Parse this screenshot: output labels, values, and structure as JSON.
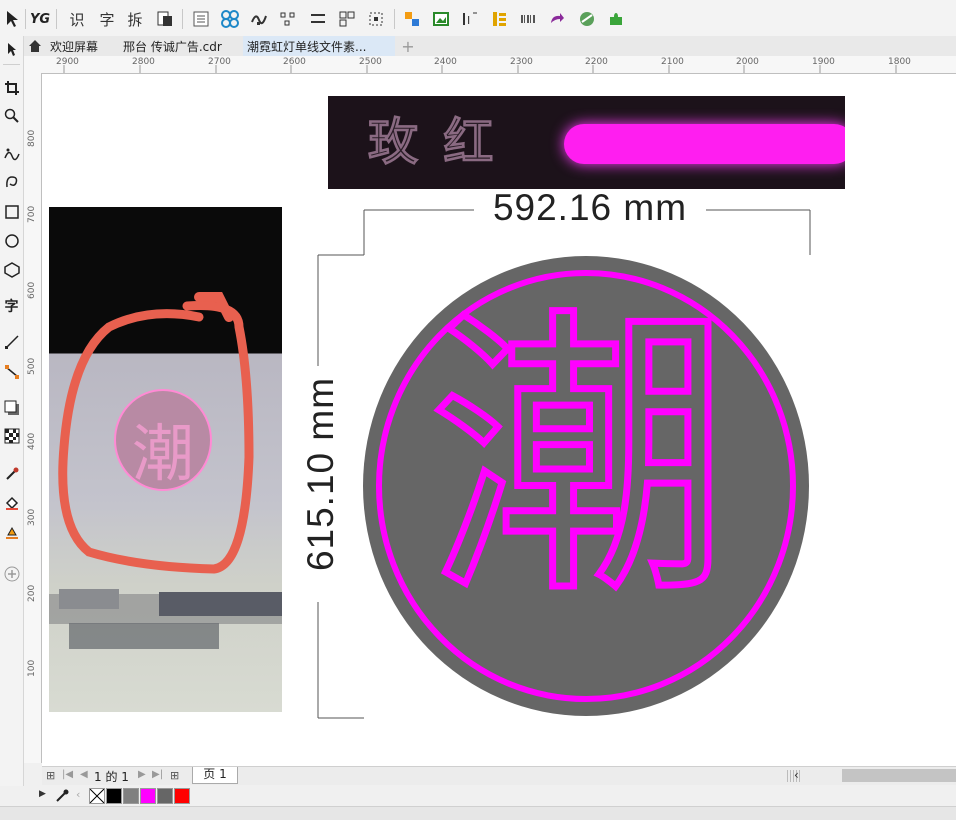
{
  "toolbar": {
    "buttons": [
      {
        "icon": "pick-arrow-icon"
      },
      {
        "icon": "yg-plugin-icon",
        "text": "YG"
      },
      {
        "icon": "recognize-icon",
        "text": "识"
      },
      {
        "icon": "text-char-icon",
        "text": "字"
      },
      {
        "icon": "split-icon",
        "text": "拆"
      },
      {
        "icon": "paste-icon"
      },
      {
        "icon": "table-icon"
      },
      {
        "icon": "pattern-icon"
      },
      {
        "icon": "node-icon"
      },
      {
        "icon": "distribute-icon"
      },
      {
        "icon": "lines-icon"
      },
      {
        "icon": "group-icon"
      },
      {
        "icon": "select-box-icon"
      },
      {
        "icon": "color-object-icon"
      },
      {
        "icon": "image-icon"
      },
      {
        "icon": "text-align-icon"
      },
      {
        "icon": "layers-icon"
      },
      {
        "icon": "barcode-icon"
      },
      {
        "icon": "redo-arrow-icon"
      },
      {
        "icon": "globe-icon"
      },
      {
        "icon": "puzzle-icon"
      }
    ]
  },
  "tabs": [
    {
      "label": "欢迎屏幕",
      "icon": "home-icon"
    },
    {
      "label": "邢台 传诚广告.cdr"
    },
    {
      "label": "潮霓虹灯单线文件素..."
    }
  ],
  "ruler": {
    "h_labels": [
      "2900",
      "2800",
      "2700",
      "2600",
      "2500",
      "2400",
      "2300",
      "2200",
      "2100",
      "2000",
      "1900",
      "1800"
    ],
    "v_labels": [
      "800",
      "700",
      "600",
      "500",
      "400",
      "300",
      "200",
      "100"
    ]
  },
  "canvas": {
    "banner_text": "玫 红",
    "dim_width": "592.16 mm",
    "dim_height": "615.10 mm",
    "char": "潮",
    "photo_char": "潮",
    "colors": {
      "magenta": "#ff00ff",
      "disc": "#666666",
      "banner_bg": "#1c121a",
      "annotation": "#e8604f"
    }
  },
  "pagebar": {
    "page_info": "1 的 1",
    "page_tab": "页 1"
  },
  "palette": {
    "swatches": [
      "none",
      "#000000",
      "#808080",
      "#ff00ff",
      "#666666",
      "#ff0000"
    ]
  }
}
